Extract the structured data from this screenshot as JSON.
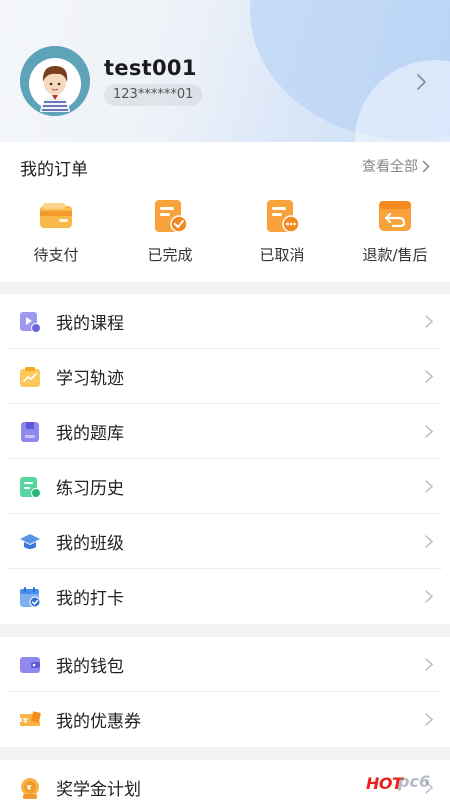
{
  "profile": {
    "username": "test001",
    "phone": "123******01"
  },
  "orders": {
    "title": "我的订单",
    "view_all": "查看全部",
    "items": [
      {
        "label": "待支付",
        "icon": "wallet-card-icon"
      },
      {
        "label": "已完成",
        "icon": "document-check-icon"
      },
      {
        "label": "已取消",
        "icon": "document-more-icon"
      },
      {
        "label": "退款/售后",
        "icon": "return-arrow-icon"
      }
    ]
  },
  "menu_groups": [
    {
      "items": [
        {
          "label": "我的课程",
          "icon": "course-play-icon"
        },
        {
          "label": "学习轨迹",
          "icon": "trend-clipboard-icon"
        },
        {
          "label": "我的题库",
          "icon": "question-bank-icon"
        },
        {
          "label": "练习历史",
          "icon": "practice-history-icon"
        },
        {
          "label": "我的班级",
          "icon": "graduation-cap-icon"
        },
        {
          "label": "我的打卡",
          "icon": "calendar-check-icon"
        }
      ]
    },
    {
      "items": [
        {
          "label": "我的钱包",
          "icon": "wallet-icon"
        },
        {
          "label": "我的优惠券",
          "icon": "coupon-icon"
        }
      ]
    },
    {
      "items": [
        {
          "label": "奖学金计划",
          "icon": "scholarship-coin-icon",
          "badge": "HOT"
        }
      ]
    }
  ],
  "watermark": "pc6",
  "colors": {
    "accent_orange": "#f7a23a",
    "accent_purple": "#7b76e8",
    "accent_green": "#3fcf8e",
    "accent_blue": "#4a8fe8",
    "hot_red": "#e8231a"
  }
}
